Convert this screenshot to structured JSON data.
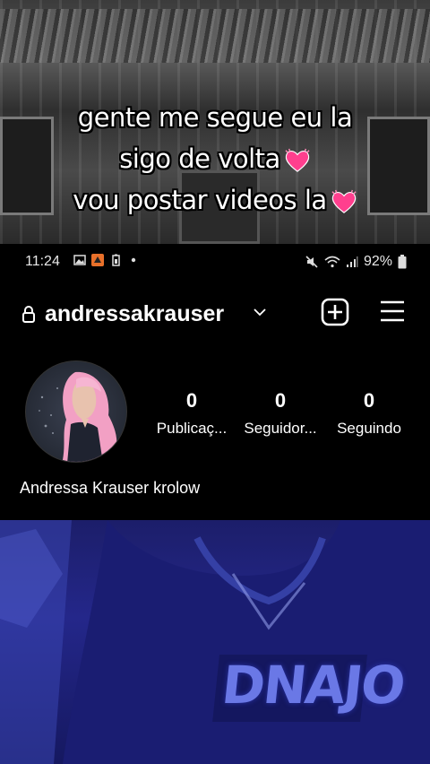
{
  "overlay": {
    "caption_lines": [
      "gente me segue eu la",
      "sigo de volta",
      "vou postar videos la"
    ]
  },
  "statusbar": {
    "time": "11:24",
    "battery": "92%"
  },
  "profile": {
    "username": "andressakrauser",
    "full_name": "Andressa Krauser krolow",
    "stats": [
      {
        "value": "0",
        "label": "Publicaç..."
      },
      {
        "value": "0",
        "label": "Seguidor..."
      },
      {
        "value": "0",
        "label": "Seguindo"
      }
    ]
  },
  "shirt_text": "DNAJO",
  "colors": {
    "heart": "#ff3f8e",
    "bottom_tint": "#24278a"
  }
}
